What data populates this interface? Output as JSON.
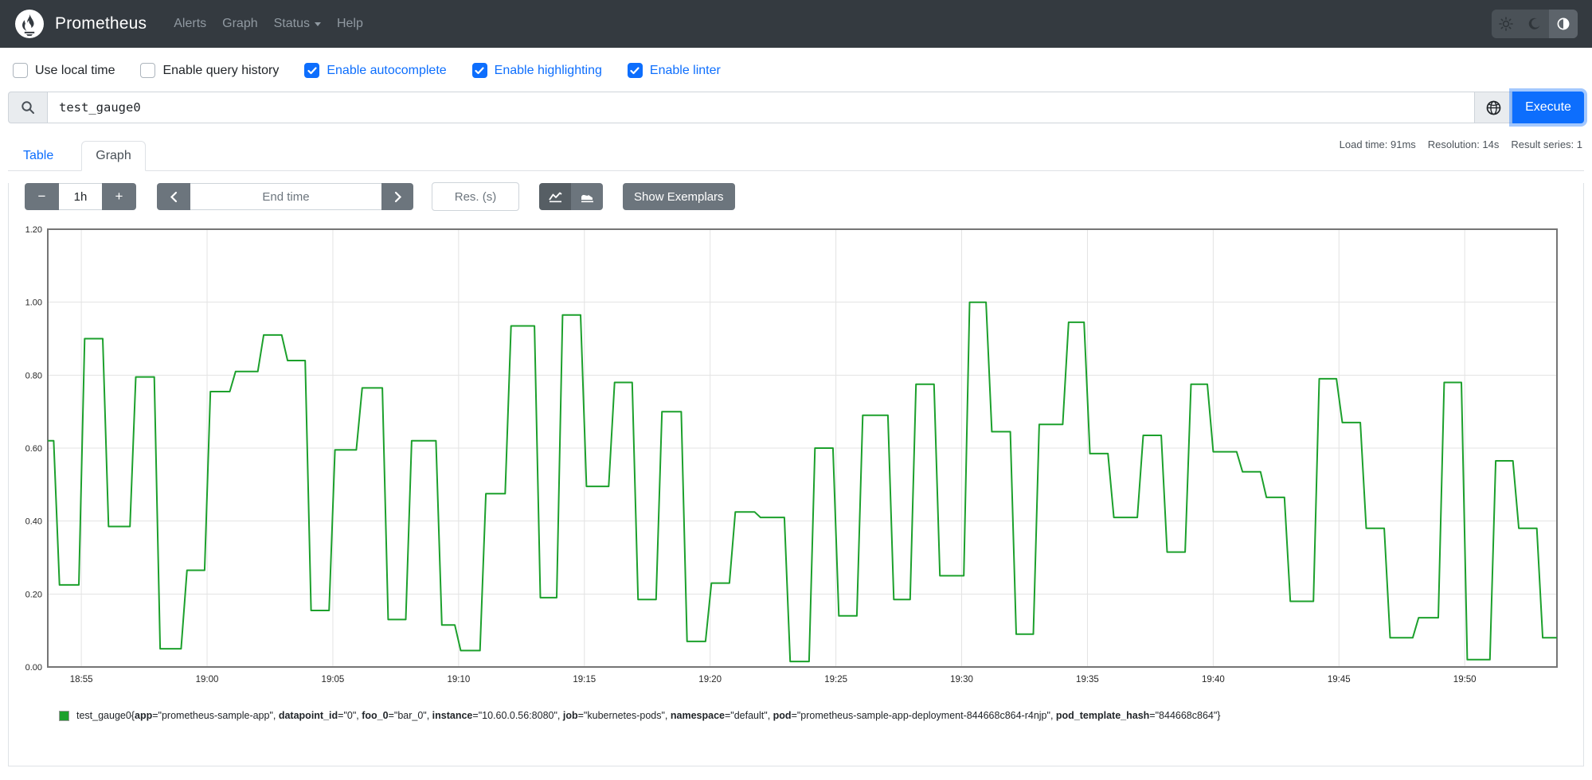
{
  "navbar": {
    "brand": "Prometheus",
    "links": [
      {
        "label": "Alerts",
        "caret": false
      },
      {
        "label": "Graph",
        "caret": false
      },
      {
        "label": "Status",
        "caret": true
      },
      {
        "label": "Help",
        "caret": false
      }
    ],
    "theme_buttons": [
      "sun-icon",
      "moon-icon",
      "auto-contrast-icon"
    ],
    "theme_active": 2,
    "bg_color": "#343a40"
  },
  "options": [
    {
      "label": "Use local time",
      "checked": false
    },
    {
      "label": "Enable query history",
      "checked": false
    },
    {
      "label": "Enable autocomplete",
      "checked": true
    },
    {
      "label": "Enable highlighting",
      "checked": true
    },
    {
      "label": "Enable linter",
      "checked": true
    }
  ],
  "query": {
    "value": "test_gauge0",
    "execute_label": "Execute",
    "accent_color": "#0d6efd"
  },
  "stats": [
    {
      "label": "Load time",
      "value": "91ms"
    },
    {
      "label": "Resolution",
      "value": "14s"
    },
    {
      "label": "Result series",
      "value": "1"
    }
  ],
  "tabs": {
    "table": "Table",
    "graph": "Graph"
  },
  "controls": {
    "minus": "−",
    "plus": "+",
    "range_value": "1h",
    "end_time_placeholder": "End time",
    "res_placeholder": "Res. (s)",
    "exemplars_label": "Show Exemplars"
  },
  "chart_data": {
    "type": "line",
    "interpolation": "step-with-14s-ramp",
    "title": "",
    "xlabel": "",
    "ylabel": "",
    "series_name": "test_gauge0",
    "series_color": "#1CA02C",
    "ylim": [
      0,
      1.2
    ],
    "x_domain_seconds": [
      0,
      3600
    ],
    "x_domain_start_time": "18:53:40",
    "step_seconds": 14,
    "grid": true,
    "y_ticks": [
      0,
      0.2,
      0.4,
      0.6,
      0.8,
      1.0,
      1.2
    ],
    "x_ticks": [
      {
        "s": 80,
        "label": "18:55"
      },
      {
        "s": 380,
        "label": "19:00"
      },
      {
        "s": 680,
        "label": "19:05"
      },
      {
        "s": 980,
        "label": "19:10"
      },
      {
        "s": 1280,
        "label": "19:15"
      },
      {
        "s": 1580,
        "label": "19:20"
      },
      {
        "s": 1880,
        "label": "19:25"
      },
      {
        "s": 2180,
        "label": "19:30"
      },
      {
        "s": 2480,
        "label": "19:35"
      },
      {
        "s": 2780,
        "label": "19:40"
      },
      {
        "s": 3080,
        "label": "19:45"
      },
      {
        "s": 3380,
        "label": "19:50"
      }
    ],
    "points": [
      [
        0,
        0.62
      ],
      [
        28,
        0.225
      ],
      [
        88,
        0.9
      ],
      [
        145,
        0.385
      ],
      [
        210,
        0.795
      ],
      [
        268,
        0.05
      ],
      [
        332,
        0.265
      ],
      [
        388,
        0.755
      ],
      [
        448,
        0.81
      ],
      [
        515,
        0.91
      ],
      [
        572,
        0.84
      ],
      [
        628,
        0.155
      ],
      [
        685,
        0.595
      ],
      [
        750,
        0.765
      ],
      [
        812,
        0.13
      ],
      [
        868,
        0.62
      ],
      [
        940,
        0.115
      ],
      [
        985,
        0.045
      ],
      [
        1045,
        0.475
      ],
      [
        1105,
        0.935
      ],
      [
        1175,
        0.19
      ],
      [
        1228,
        0.965
      ],
      [
        1285,
        0.495
      ],
      [
        1352,
        0.78
      ],
      [
        1408,
        0.185
      ],
      [
        1465,
        0.7
      ],
      [
        1525,
        0.07
      ],
      [
        1583,
        0.23
      ],
      [
        1640,
        0.425
      ],
      [
        1700,
        0.41
      ],
      [
        1771,
        0.015
      ],
      [
        1830,
        0.6
      ],
      [
        1887,
        0.14
      ],
      [
        1944,
        0.69
      ],
      [
        2018,
        0.185
      ],
      [
        2071,
        0.775
      ],
      [
        2128,
        0.25
      ],
      [
        2199,
        1.0
      ],
      [
        2252,
        0.645
      ],
      [
        2310,
        0.09
      ],
      [
        2365,
        0.665
      ],
      [
        2435,
        0.945
      ],
      [
        2486,
        0.585
      ],
      [
        2543,
        0.41
      ],
      [
        2613,
        0.635
      ],
      [
        2670,
        0.315
      ],
      [
        2727,
        0.775
      ],
      [
        2780,
        0.59
      ],
      [
        2850,
        0.535
      ],
      [
        2907,
        0.465
      ],
      [
        2964,
        0.18
      ],
      [
        3033,
        0.79
      ],
      [
        3088,
        0.67
      ],
      [
        3145,
        0.38
      ],
      [
        3202,
        0.08
      ],
      [
        3270,
        0.135
      ],
      [
        3331,
        0.78
      ],
      [
        3386,
        0.02
      ],
      [
        3454,
        0.565
      ],
      [
        3509,
        0.38
      ],
      [
        3566,
        0.08
      ]
    ]
  },
  "legend": {
    "swatch_color": "#1CA02C",
    "segments": [
      {
        "text": "test_gauge0{",
        "bold": false
      },
      {
        "text": "app",
        "bold": true
      },
      {
        "text": "=\"prometheus-sample-app\", ",
        "bold": false
      },
      {
        "text": "datapoint_id",
        "bold": true
      },
      {
        "text": "=\"0\", ",
        "bold": false
      },
      {
        "text": "foo_0",
        "bold": true
      },
      {
        "text": "=\"bar_0\", ",
        "bold": false
      },
      {
        "text": "instance",
        "bold": true
      },
      {
        "text": "=\"10.60.0.56:8080\", ",
        "bold": false
      },
      {
        "text": "job",
        "bold": true
      },
      {
        "text": "=\"kubernetes-pods\", ",
        "bold": false
      },
      {
        "text": "namespace",
        "bold": true
      },
      {
        "text": "=\"default\", ",
        "bold": false
      },
      {
        "text": "pod",
        "bold": true
      },
      {
        "text": "=\"prometheus-sample-app-deployment-844668c864-r4njp\", ",
        "bold": false
      },
      {
        "text": "pod_template_hash",
        "bold": true
      },
      {
        "text": "=\"844668c864\"}",
        "bold": false
      }
    ]
  }
}
